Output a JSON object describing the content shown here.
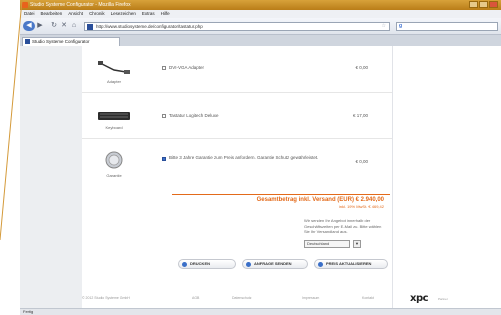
{
  "window": {
    "title": "Studio Systeme Configurator - Mozilla Firefox"
  },
  "menu": [
    "Datei",
    "Bearbeiten",
    "Ansicht",
    "Chronik",
    "Lesezeichen",
    "Extras",
    "Hilfe"
  ],
  "address": {
    "url": "http://www.studiosysteme.de/configurator/tastatur.php"
  },
  "tab": {
    "label": "Studio Systeme Configurator"
  },
  "items": [
    {
      "caption": "Adapter",
      "label": "DVI-VGA Adapter",
      "price": "€ 0,00",
      "checked": false,
      "icon": "adapter-cable-icon"
    },
    {
      "caption": "Keyboard",
      "label": "Tastatur Logitech Deluxe",
      "price": "€ 17,00",
      "checked": false,
      "icon": "keyboard-icon"
    },
    {
      "caption": "Garantie",
      "label": "Bitte 3 Jahre Garantie zum Preis anfordern. Garantie Schutz gewährleistet.",
      "price": "€ 0,00",
      "checked": true,
      "icon": "warranty-badge-icon"
    }
  ],
  "summary": {
    "total": "Gesamtbetrag inkl. Versand (EUR) € 2.940,00",
    "sub": "inkl. 19% MwSt. € 469,42",
    "info": "Wir senden Ihr Angebot innerhalb der Geschäftszeiten per E-Mail zu. Bitte wählen Sie Ihr Versandland aus.",
    "country": "Deutschland"
  },
  "actions": [
    {
      "label": "DRUCKEN"
    },
    {
      "label": "ANFRAGE SENDEN"
    },
    {
      "label": "PREIS AKTUALISIEREN"
    }
  ],
  "footer": {
    "copyright": "© 2012 Studio Systeme GmbH",
    "links": [
      "AGB",
      "Datenschutz",
      "Impressum",
      "Kontakt"
    ],
    "logo": "xpc",
    "logo_sub": "Partner"
  },
  "status": {
    "text": "Fertig"
  },
  "colors": {
    "accent": "#e36a1a",
    "title_bar": "#c98f28",
    "link_blue": "#3a6fc8"
  }
}
